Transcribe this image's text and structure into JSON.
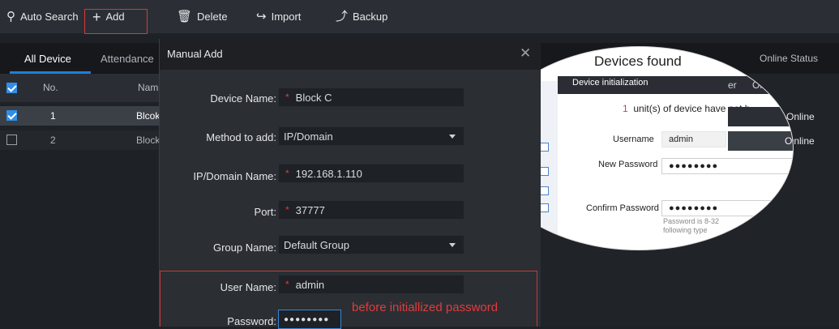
{
  "toolbar": {
    "auto_search": "Auto Search",
    "add": "Add",
    "delete": "Delete",
    "import": "Import",
    "backup": "Backup"
  },
  "tabs": [
    "All Device",
    "Attendance"
  ],
  "grid": {
    "headers": [
      "No.",
      "Nam"
    ],
    "rows": [
      {
        "no": "1",
        "name": "Blcok",
        "checked": true
      },
      {
        "no": "2",
        "name": "Block",
        "checked": false
      }
    ]
  },
  "modal": {
    "title": "Manual Add",
    "fields": {
      "device_name_label": "Device Name:",
      "device_name_value": "Block C",
      "method_label": "Method to add:",
      "method_value": "IP/Domain",
      "ip_label": "IP/Domain Name:",
      "ip_value": "192.168.1.110",
      "port_label": "Port:",
      "port_value": "37777",
      "group_label": "Group Name:",
      "group_value": "Default Group",
      "user_label": "User Name:",
      "user_value": "admin",
      "password_label": "Password:",
      "password_value": "●●●●●●●●"
    },
    "annotation": "before initiallized password"
  },
  "right": {
    "header_online_status": "Online Status",
    "status_values": [
      "Online",
      "Online"
    ]
  },
  "lens": {
    "devices_found": "Devices found",
    "title": "Device initialization",
    "col_short": "er",
    "online_status": "Online Status",
    "message_count": "1",
    "message": "unit(s) of device have not b",
    "username_label": "Username",
    "username_value": "admin",
    "new_password_label": "New Password",
    "new_password_value": "●●●●●●●●",
    "confirm_password_label": "Confirm Password",
    "confirm_password_value": "●●●●●●●●",
    "hint1": "Password is 8-32",
    "hint2": "following type",
    "online_rows": [
      "Online",
      "Online"
    ],
    "icon_ip": "IP"
  },
  "colors": {
    "accent_blue": "#1e7fd8",
    "highlight_red": "#d23a3a"
  }
}
